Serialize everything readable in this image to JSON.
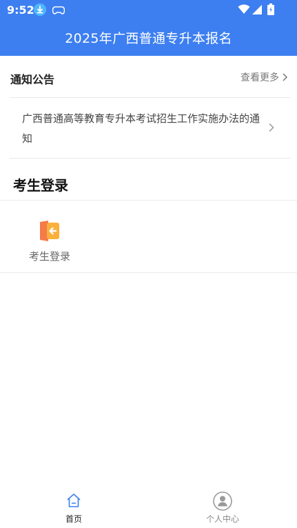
{
  "status_bar": {
    "time": "9:52",
    "icons": [
      "download-icon",
      "gamepad-icon",
      "wifi-icon",
      "signal-icon",
      "battery-icon"
    ]
  },
  "header": {
    "title": "2025年广西普通专升本报名",
    "color": "#3d7ff0"
  },
  "notice": {
    "section_title": "通知公告",
    "more_label": "查看更多",
    "items": [
      {
        "text": "广西普通高等教育专升本考试招生工作实施办法的通知"
      }
    ]
  },
  "candidate": {
    "section_title": "考生登录",
    "tiles": [
      {
        "label": "考生登录",
        "icon": "login-door-icon"
      }
    ]
  },
  "tabbar": {
    "tabs": [
      {
        "label": "首页",
        "icon": "home-icon",
        "active": true
      },
      {
        "label": "个人中心",
        "icon": "user-center-icon",
        "active": false
      }
    ]
  }
}
